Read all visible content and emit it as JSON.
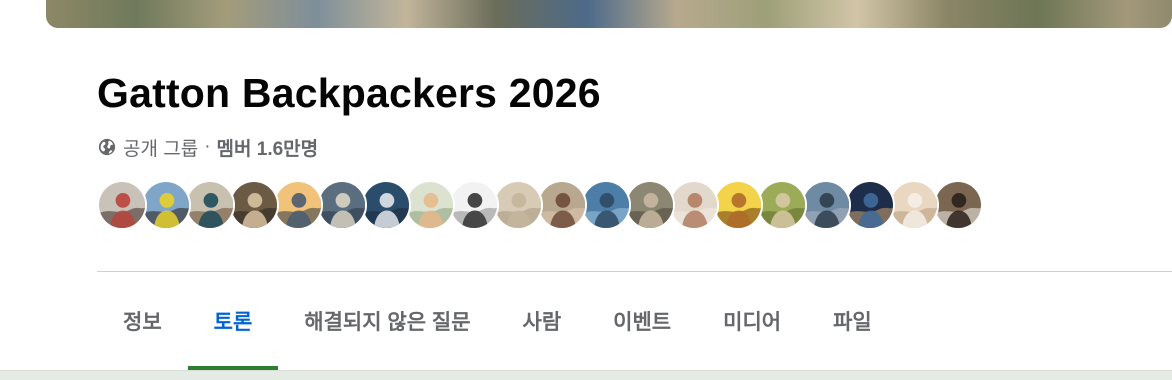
{
  "group": {
    "title": "Gatton Backpackers 2026",
    "privacy": "공개 그룹",
    "separator": "·",
    "members": "멤버 1.6만명"
  },
  "avatars": [
    {
      "name": "member-1",
      "colors": [
        "#c9c2b8",
        "#b9443c",
        "#3b2a22"
      ]
    },
    {
      "name": "member-2",
      "colors": [
        "#7fa6c9",
        "#e8d12a",
        "#2b1e17"
      ]
    },
    {
      "name": "member-3",
      "colors": [
        "#c8c1b0",
        "#1f4c5b",
        "#6b4a35"
      ]
    },
    {
      "name": "member-4",
      "colors": [
        "#6b5a44",
        "#d9c3a0",
        "#2a2420"
      ]
    },
    {
      "name": "member-5",
      "colors": [
        "#f0c27a",
        "#4a5c70",
        "#2e3a46"
      ]
    },
    {
      "name": "member-6",
      "colors": [
        "#5a6e80",
        "#d9d4c4",
        "#263646"
      ]
    },
    {
      "name": "member-7",
      "colors": [
        "#2b4d6c",
        "#e2e6ea",
        "#1a2a3a"
      ]
    },
    {
      "name": "member-8",
      "colors": [
        "#dbe3d0",
        "#e6b98a",
        "#8aa07a"
      ]
    },
    {
      "name": "member-9",
      "colors": [
        "#f2f2f2",
        "#333333",
        "#8a8a8a"
      ]
    },
    {
      "name": "member-10",
      "colors": [
        "#d8cbb6",
        "#c4b59c",
        "#a8977e"
      ]
    },
    {
      "name": "member-11",
      "colors": [
        "#b7a88f",
        "#6e4b3a",
        "#e2c6b4"
      ]
    },
    {
      "name": "member-12",
      "colors": [
        "#4c7ea8",
        "#2f4a63",
        "#9fc2dc"
      ]
    },
    {
      "name": "member-13",
      "colors": [
        "#8c8773",
        "#c9b8a1",
        "#4c4538"
      ]
    },
    {
      "name": "member-14",
      "colors": [
        "#e3d8cc",
        "#b07e62",
        "#f3ece4"
      ]
    },
    {
      "name": "member-15",
      "colors": [
        "#f2d34a",
        "#b06a2a",
        "#6b3a14"
      ]
    },
    {
      "name": "member-16",
      "colors": [
        "#9cab58",
        "#d8c9a4",
        "#5d6a2c"
      ]
    },
    {
      "name": "member-17",
      "colors": [
        "#6f8aa3",
        "#2e3d4b",
        "#a9b5bf"
      ]
    },
    {
      "name": "member-18",
      "colors": [
        "#1e2d4a",
        "#3f6b9b",
        "#d1a46b"
      ]
    },
    {
      "name": "member-19",
      "colors": [
        "#e9d7c1",
        "#f4efe8",
        "#b89a7c"
      ]
    },
    {
      "name": "member-20",
      "colors": [
        "#7b6652",
        "#2a211a",
        "#f1eee9"
      ]
    }
  ],
  "tabs": [
    {
      "label": "정보",
      "active": false
    },
    {
      "label": "토론",
      "active": true
    },
    {
      "label": "해결되지 않은 질문",
      "active": false
    },
    {
      "label": "사람",
      "active": false
    },
    {
      "label": "이벤트",
      "active": false
    },
    {
      "label": "미디어",
      "active": false
    },
    {
      "label": "파일",
      "active": false
    }
  ],
  "colors": {
    "active_tab": "#0064d1",
    "active_underline": "#2e7d32",
    "muted_text": "#65676b",
    "title_text": "#050505"
  },
  "icons": {
    "privacy": "globe-icon"
  }
}
